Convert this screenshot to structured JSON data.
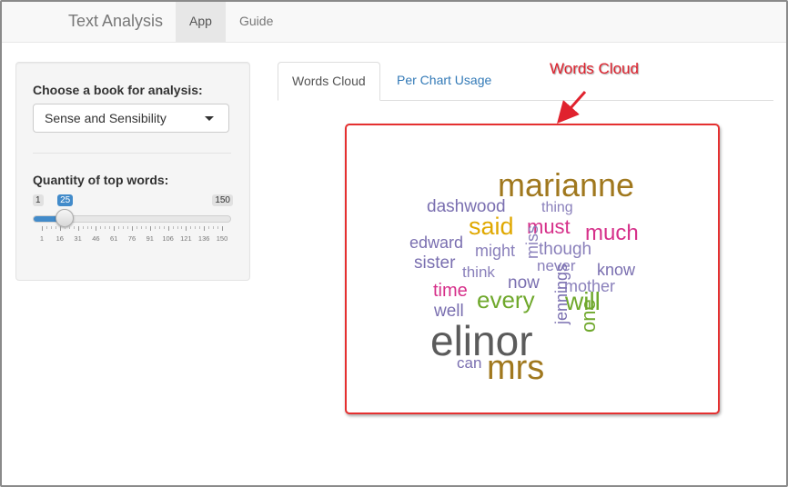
{
  "navbar": {
    "brand": "Text Analysis",
    "items": [
      {
        "label": "App",
        "active": true
      },
      {
        "label": "Guide",
        "active": false
      }
    ]
  },
  "sidebar": {
    "book_label": "Choose a book for analysis:",
    "book_selected": "Sense and Sensibility",
    "quantity_label": "Quantity of top words:",
    "slider": {
      "min": "1",
      "max": "150",
      "value": "25",
      "value_fraction": 0.161,
      "tick_labels": [
        "1",
        "16",
        "31",
        "46",
        "61",
        "76",
        "91",
        "106",
        "121",
        "136",
        "150"
      ]
    }
  },
  "tabs": [
    {
      "label": "Words Cloud",
      "active": true
    },
    {
      "label": "Per Chart Usage",
      "active": false
    }
  ],
  "annotation": {
    "text": "Words Cloud",
    "color": "#e0222e"
  },
  "colors": {
    "accent": "#428bca",
    "border_highlight": "#e53030"
  },
  "word_cloud": [
    {
      "word": "marianne",
      "color": "#a0781e"
    },
    {
      "word": "elinor",
      "color": "#5b5b5b"
    },
    {
      "word": "mrs",
      "color": "#a0781e"
    },
    {
      "word": "dashwood",
      "color": "#7a6fb0"
    },
    {
      "word": "thing",
      "color": "#8a80bb"
    },
    {
      "word": "said",
      "color": "#e0a800"
    },
    {
      "word": "must",
      "color": "#d6308a"
    },
    {
      "word": "much",
      "color": "#d6308a"
    },
    {
      "word": "edward",
      "color": "#7a6fb0"
    },
    {
      "word": "might",
      "color": "#8a80bb"
    },
    {
      "word": "miss",
      "color": "#8a80bb"
    },
    {
      "word": "though",
      "color": "#8a80bb"
    },
    {
      "word": "sister",
      "color": "#7a6fb0"
    },
    {
      "word": "think",
      "color": "#8a80bb"
    },
    {
      "word": "never",
      "color": "#8a80bb"
    },
    {
      "word": "know",
      "color": "#7a6fb0"
    },
    {
      "word": "now",
      "color": "#7a6fb0"
    },
    {
      "word": "mother",
      "color": "#8a80bb"
    },
    {
      "word": "time",
      "color": "#d6308a"
    },
    {
      "word": "every",
      "color": "#6fa82c"
    },
    {
      "word": "will",
      "color": "#6fa82c"
    },
    {
      "word": "well",
      "color": "#7a6fb0"
    },
    {
      "word": "jennings",
      "color": "#7a6fb0"
    },
    {
      "word": "one",
      "color": "#6fa82c"
    },
    {
      "word": "can",
      "color": "#7a6fb0"
    }
  ]
}
